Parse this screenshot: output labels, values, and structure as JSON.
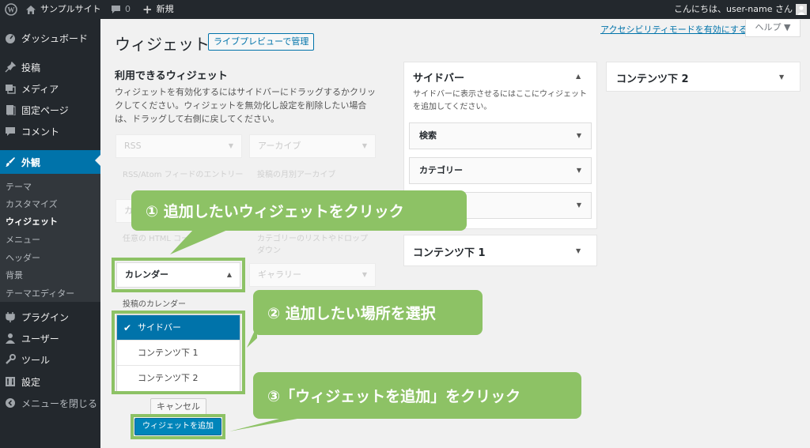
{
  "adminbar": {
    "site_name": "サンプルサイト",
    "comment_count": "0",
    "new_label": "新規",
    "greeting": "こんにちは、user-name さん"
  },
  "sidebar": {
    "items": [
      {
        "label": "ダッシュボード",
        "icon": "dashboard-icon"
      },
      {
        "label": "投稿",
        "icon": "pin-icon"
      },
      {
        "label": "メディア",
        "icon": "media-icon"
      },
      {
        "label": "固定ページ",
        "icon": "page-icon"
      },
      {
        "label": "コメント",
        "icon": "comment-icon"
      },
      {
        "label": "外観",
        "icon": "brush-icon"
      },
      {
        "label": "プラグイン",
        "icon": "plugin-icon"
      },
      {
        "label": "ユーザー",
        "icon": "user-icon"
      },
      {
        "label": "ツール",
        "icon": "wrench-icon"
      },
      {
        "label": "設定",
        "icon": "settings-icon"
      },
      {
        "label": "メニューを閉じる",
        "icon": "collapse-icon"
      }
    ],
    "submenu": [
      "テーマ",
      "カスタマイズ",
      "ウィジェット",
      "メニュー",
      "ヘッダー",
      "背景",
      "テーマエディター"
    ]
  },
  "header": {
    "title": "ウィジェット",
    "preview_button": "ライブプレビューで管理",
    "a11y_link": "アクセシビリティモードを有効にする",
    "help": "ヘルプ ▼"
  },
  "available": {
    "title": "利用できるウィジェット",
    "description": "ウィジェットを有効化するにはサイドバーにドラッグするかクリックしてください。ウィジェットを無効化し設定を削除したい場合は、ドラッグして右側に戻してください。",
    "ghost": [
      "RSS",
      "アーカイブ",
      "カ",
      "ギャラリー"
    ],
    "ghost_desc": [
      "RSS/Atom フィードのエントリー",
      "投稿の月別アーカイブ",
      "任意の HTML コー",
      "カテゴリーのリストやドロップ",
      "ダウン"
    ],
    "calendar": {
      "title": "カレンダー",
      "description": "投稿のカレンダー",
      "choices": [
        "サイドバー",
        "コンテンツ下 1",
        "コンテンツ下 2"
      ],
      "cancel": "キャンセル",
      "add": "ウィジェットを追加"
    }
  },
  "areas": {
    "sidebar": {
      "title": "サイドバー",
      "description": "サイドバーに表示させるにはここにウィジェットを追加してください。",
      "widgets": [
        "検索",
        "カテゴリー",
        ""
      ]
    },
    "content1": {
      "title": "コンテンツ下 1"
    },
    "content2": {
      "title": "コンテンツ下 2"
    }
  },
  "callouts": [
    "① 追加したいウィジェットをクリック",
    "② 追加したい場所を選択",
    "③「ウィジェットを追加」をクリック"
  ],
  "colors": {
    "accent": "#0073aa",
    "callout": "#8dc265",
    "sidebar_bg": "#23282d"
  }
}
